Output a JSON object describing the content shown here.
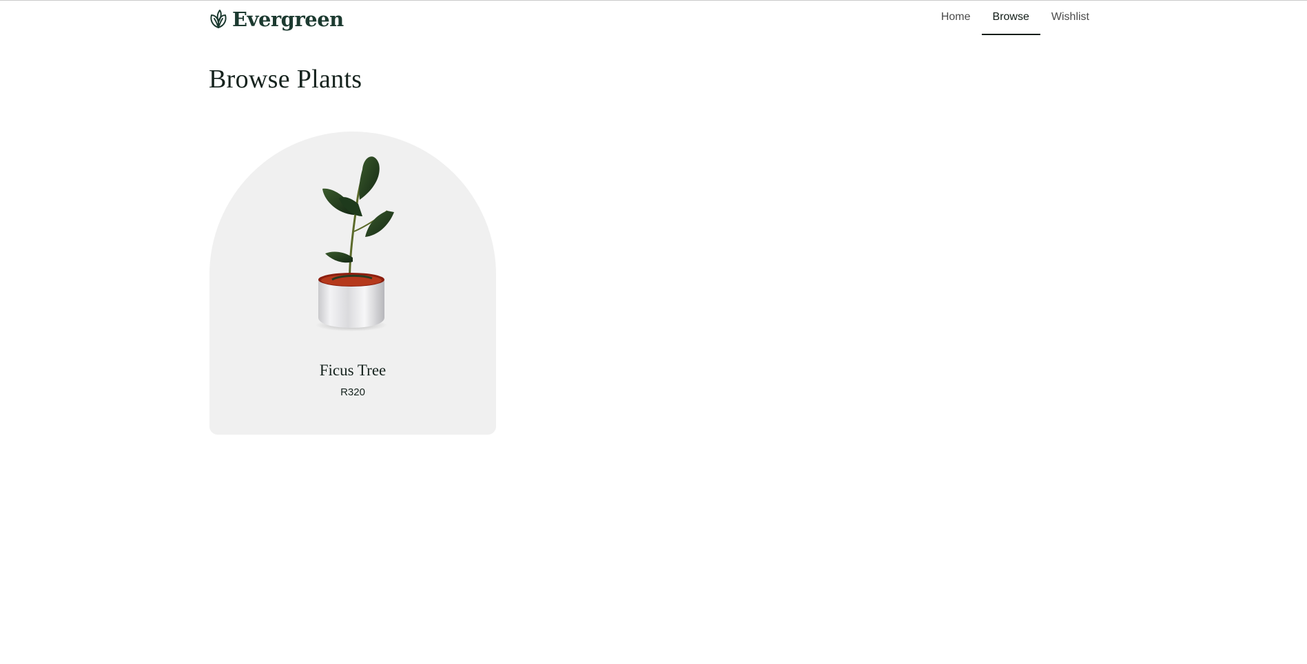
{
  "brand": {
    "name": "Evergreen",
    "icon": "leaf-icon",
    "color": "#1c3a30"
  },
  "nav": {
    "items": [
      {
        "label": "Home",
        "active": false
      },
      {
        "label": "Browse",
        "active": true
      },
      {
        "label": "Wishlist",
        "active": false
      }
    ]
  },
  "page": {
    "title": "Browse Plants"
  },
  "products": [
    {
      "name": "Ficus Tree",
      "price": "R320",
      "image": "ficus-plant-image"
    }
  ],
  "colors": {
    "card_background": "#f0f0f0",
    "text": "#16231e",
    "active_nav": "#111c17"
  }
}
